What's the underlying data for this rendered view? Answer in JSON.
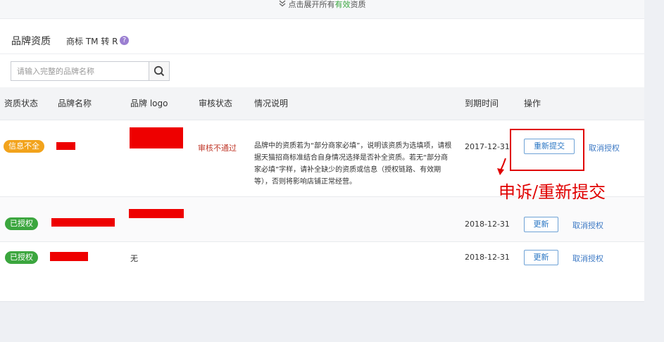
{
  "expand_bar": {
    "prefix": "点击展开所有",
    "highlight": "有效",
    "suffix": "资质"
  },
  "tabs": {
    "main": "品牌资质",
    "sub": "商标 TM 转 R",
    "help_glyph": "?"
  },
  "search": {
    "placeholder": "请输入完整的品牌名称"
  },
  "table": {
    "headers": {
      "status": "资质状态",
      "brand": "品牌名称",
      "logo": "品牌 logo",
      "review": "审核状态",
      "desc": "情况说明",
      "expire": "到期时间",
      "action": "操作"
    },
    "rows": [
      {
        "status": "信息不全",
        "review": "审核不通过",
        "desc": "品牌中的资质若为“部分商家必填”，说明该资质为选填项，请根据天猫招商标准结合自身情况选择是否补全资质。若无“部分商家必填”字样，请补全缺少的资质或信息（授权链路、有效期等），否则将影响店铺正常经营。",
        "expire": "2017-12-31",
        "action_primary": "重新提交",
        "action_link": "取消授权"
      },
      {
        "status": "已授权",
        "expire": "2018-12-31",
        "action_primary": "更新",
        "action_link": "取消授权"
      },
      {
        "status": "已授权",
        "logo_text": "无",
        "expire": "2018-12-31",
        "action_primary": "更新",
        "action_link": "取消授权"
      }
    ]
  },
  "annotation": {
    "text": "申诉/重新提交",
    "color": "#e00000"
  },
  "colors": {
    "warn": "#f2a31c",
    "ok": "#3ba63e",
    "link": "#3b78c4",
    "redaction": "#ee0000"
  }
}
